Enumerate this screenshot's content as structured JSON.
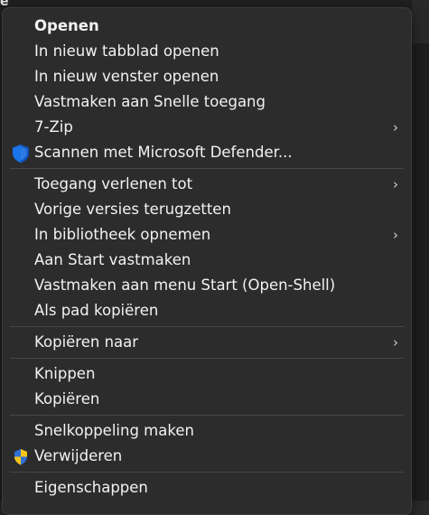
{
  "background": {
    "fragment_text": "e"
  },
  "menu": {
    "items": [
      {
        "label": "Openen"
      },
      {
        "label": "In nieuw tabblad openen"
      },
      {
        "label": "In nieuw venster openen"
      },
      {
        "label": "Vastmaken aan Snelle toegang"
      },
      {
        "label": "7-Zip",
        "submenu_chevron": "›"
      },
      {
        "label": "Scannen met Microsoft Defender...",
        "icon": "defender-shield-icon"
      },
      {
        "label": "Toegang verlenen tot",
        "submenu_chevron": "›"
      },
      {
        "label": "Vorige versies terugzetten"
      },
      {
        "label": "In bibliotheek opnemen",
        "submenu_chevron": "›"
      },
      {
        "label": "Aan Start vastmaken"
      },
      {
        "label": "Vastmaken aan menu Start (Open-Shell)"
      },
      {
        "label": "Als pad kopiëren"
      },
      {
        "label": "Kopiëren naar",
        "submenu_chevron": "›"
      },
      {
        "label": "Knippen"
      },
      {
        "label": "Kopiëren"
      },
      {
        "label": "Snelkoppeling maken"
      },
      {
        "label": "Verwijderen",
        "icon": "uac-shield-icon"
      },
      {
        "label": "Eigenschappen"
      }
    ]
  },
  "colors": {
    "menu_background": "#2c2c2c",
    "text": "#f2f2f2",
    "separator": "#464646",
    "defender_blue": "#1a73e8",
    "uac_blue": "#2f6fd6",
    "uac_yellow": "#f5c518"
  }
}
